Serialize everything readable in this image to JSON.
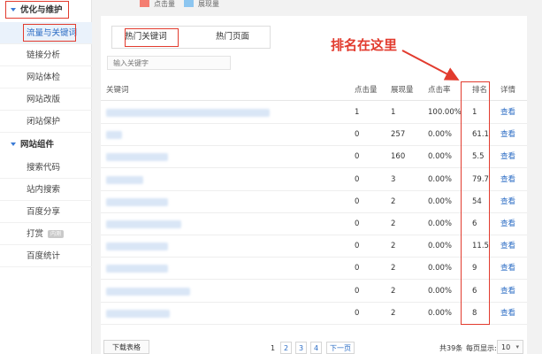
{
  "sidebar": {
    "group1": "优化与维护",
    "items1": [
      "流量与关键词",
      "链接分析",
      "网站体检",
      "网站改版",
      "闭站保护"
    ],
    "group2": "网站组件",
    "items2": [
      "搜索代码",
      "站内搜索",
      "百度分享",
      "打赏",
      "百度统计"
    ],
    "badge": "内测"
  },
  "legend": {
    "clicks": "点击量",
    "views": "展现量",
    "clicks_color": "#f47d71",
    "views_color": "#8dc6f0"
  },
  "tabs": [
    "热门关键词",
    "热门页面"
  ],
  "search": {
    "placeholder": "输入关键字"
  },
  "annotation": "排名在这里",
  "table": {
    "headers": [
      "关键词",
      "点击量",
      "展现量",
      "点击率",
      "排名",
      "详情"
    ],
    "rows": [
      {
        "clicks": "1",
        "views": "1",
        "ctr": "100.00%",
        "rank": "1",
        "detail": "查看"
      },
      {
        "clicks": "0",
        "views": "257",
        "ctr": "0.00%",
        "rank": "61.1",
        "detail": "查看"
      },
      {
        "clicks": "0",
        "views": "160",
        "ctr": "0.00%",
        "rank": "5.5",
        "detail": "查看"
      },
      {
        "clicks": "0",
        "views": "3",
        "ctr": "0.00%",
        "rank": "79.7",
        "detail": "查看"
      },
      {
        "clicks": "0",
        "views": "2",
        "ctr": "0.00%",
        "rank": "54",
        "detail": "查看"
      },
      {
        "clicks": "0",
        "views": "2",
        "ctr": "0.00%",
        "rank": "6",
        "detail": "查看"
      },
      {
        "clicks": "0",
        "views": "2",
        "ctr": "0.00%",
        "rank": "11.5",
        "detail": "查看"
      },
      {
        "clicks": "0",
        "views": "2",
        "ctr": "0.00%",
        "rank": "9",
        "detail": "查看"
      },
      {
        "clicks": "0",
        "views": "2",
        "ctr": "0.00%",
        "rank": "6",
        "detail": "查看"
      },
      {
        "clicks": "0",
        "views": "2",
        "ctr": "0.00%",
        "rank": "8",
        "detail": "查看"
      }
    ]
  },
  "footer": {
    "download": "下载表格",
    "pages": [
      "1",
      "2",
      "3",
      "4"
    ],
    "next": "下一页",
    "total": "共39条",
    "per_page_label": "每页显示:",
    "per_page": "10"
  }
}
